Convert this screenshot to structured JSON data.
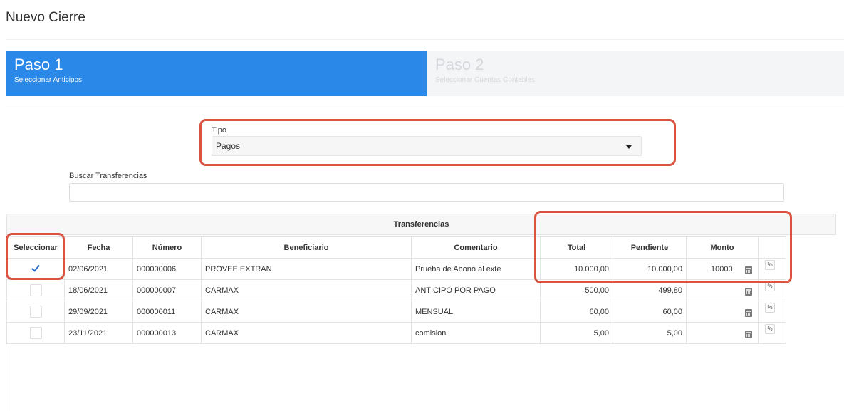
{
  "page": {
    "title": "Nuevo Cierre"
  },
  "steps": [
    {
      "title": "Paso 1",
      "subtitle": "Seleccionar Anticipos",
      "active": true
    },
    {
      "title": "Paso 2",
      "subtitle": "Seleccionar Cuentas Contables",
      "active": false
    }
  ],
  "tipo": {
    "label": "Tipo",
    "value": "Pagos"
  },
  "search": {
    "label": "Buscar Transferencias",
    "value": ""
  },
  "table": {
    "caption": "Transferencias",
    "headers": [
      "Seleccionar",
      "Fecha",
      "Número",
      "Beneficiario",
      "Comentario",
      "Total",
      "Pendiente",
      "Monto",
      ""
    ],
    "rows": [
      {
        "selected": true,
        "fecha": "02/06/2021",
        "numero": "000000006",
        "beneficiario": "PROVEE EXTRAN",
        "comentario": "Prueba de Abono al exte",
        "total": "10.000,00",
        "pendiente": "10.000,00",
        "monto": "10000"
      },
      {
        "selected": false,
        "fecha": "18/06/2021",
        "numero": "000000007",
        "beneficiario": "CARMAX",
        "comentario": "ANTICIPO POR PAGO",
        "total": "500,00",
        "pendiente": "499,80",
        "monto": ""
      },
      {
        "selected": false,
        "fecha": "29/09/2021",
        "numero": "000000011",
        "beneficiario": "CARMAX",
        "comentario": "MENSUAL",
        "total": "60,00",
        "pendiente": "60,00",
        "monto": ""
      },
      {
        "selected": false,
        "fecha": "23/11/2021",
        "numero": "000000013",
        "beneficiario": "CARMAX",
        "comentario": "comision",
        "total": "5,00",
        "pendiente": "5,00",
        "monto": ""
      }
    ]
  },
  "icons": {
    "calc": "calculator-icon",
    "link": "link-icon",
    "caret": "caret-down-icon",
    "check": "checkmark-icon"
  },
  "colors": {
    "accent": "#2a88e8",
    "highlight": "#d9533f",
    "step_inactive_bg": "#f4f5f7"
  }
}
